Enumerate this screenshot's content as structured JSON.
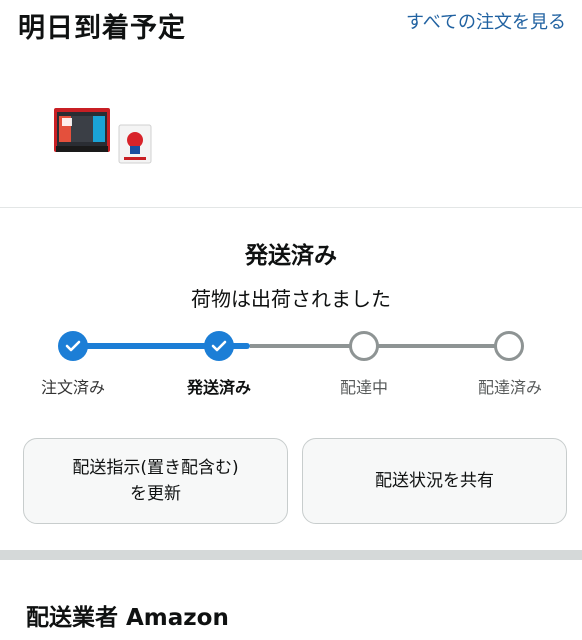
{
  "header": {
    "title": "明日到着予定",
    "view_all_link": "すべての注文を見る"
  },
  "status": {
    "title": "発送済み",
    "subtitle": "荷物は出荷されました"
  },
  "tracker": {
    "steps": [
      {
        "label": "注文済み",
        "state": "done"
      },
      {
        "label": "発送済み",
        "state": "done"
      },
      {
        "label": "配達中",
        "state": "pending"
      },
      {
        "label": "配達済み",
        "state": "pending"
      }
    ],
    "progress_color": "#1c7ed6",
    "pending_color": "#8e9494"
  },
  "actions": {
    "update_instructions": "配送指示(置き配含む)を更新",
    "share_status": "配送状況を共有"
  },
  "carrier": {
    "label": "配送業者 Amazon"
  },
  "colors": {
    "link": "#2162a1",
    "accent": "#1c7ed6"
  }
}
